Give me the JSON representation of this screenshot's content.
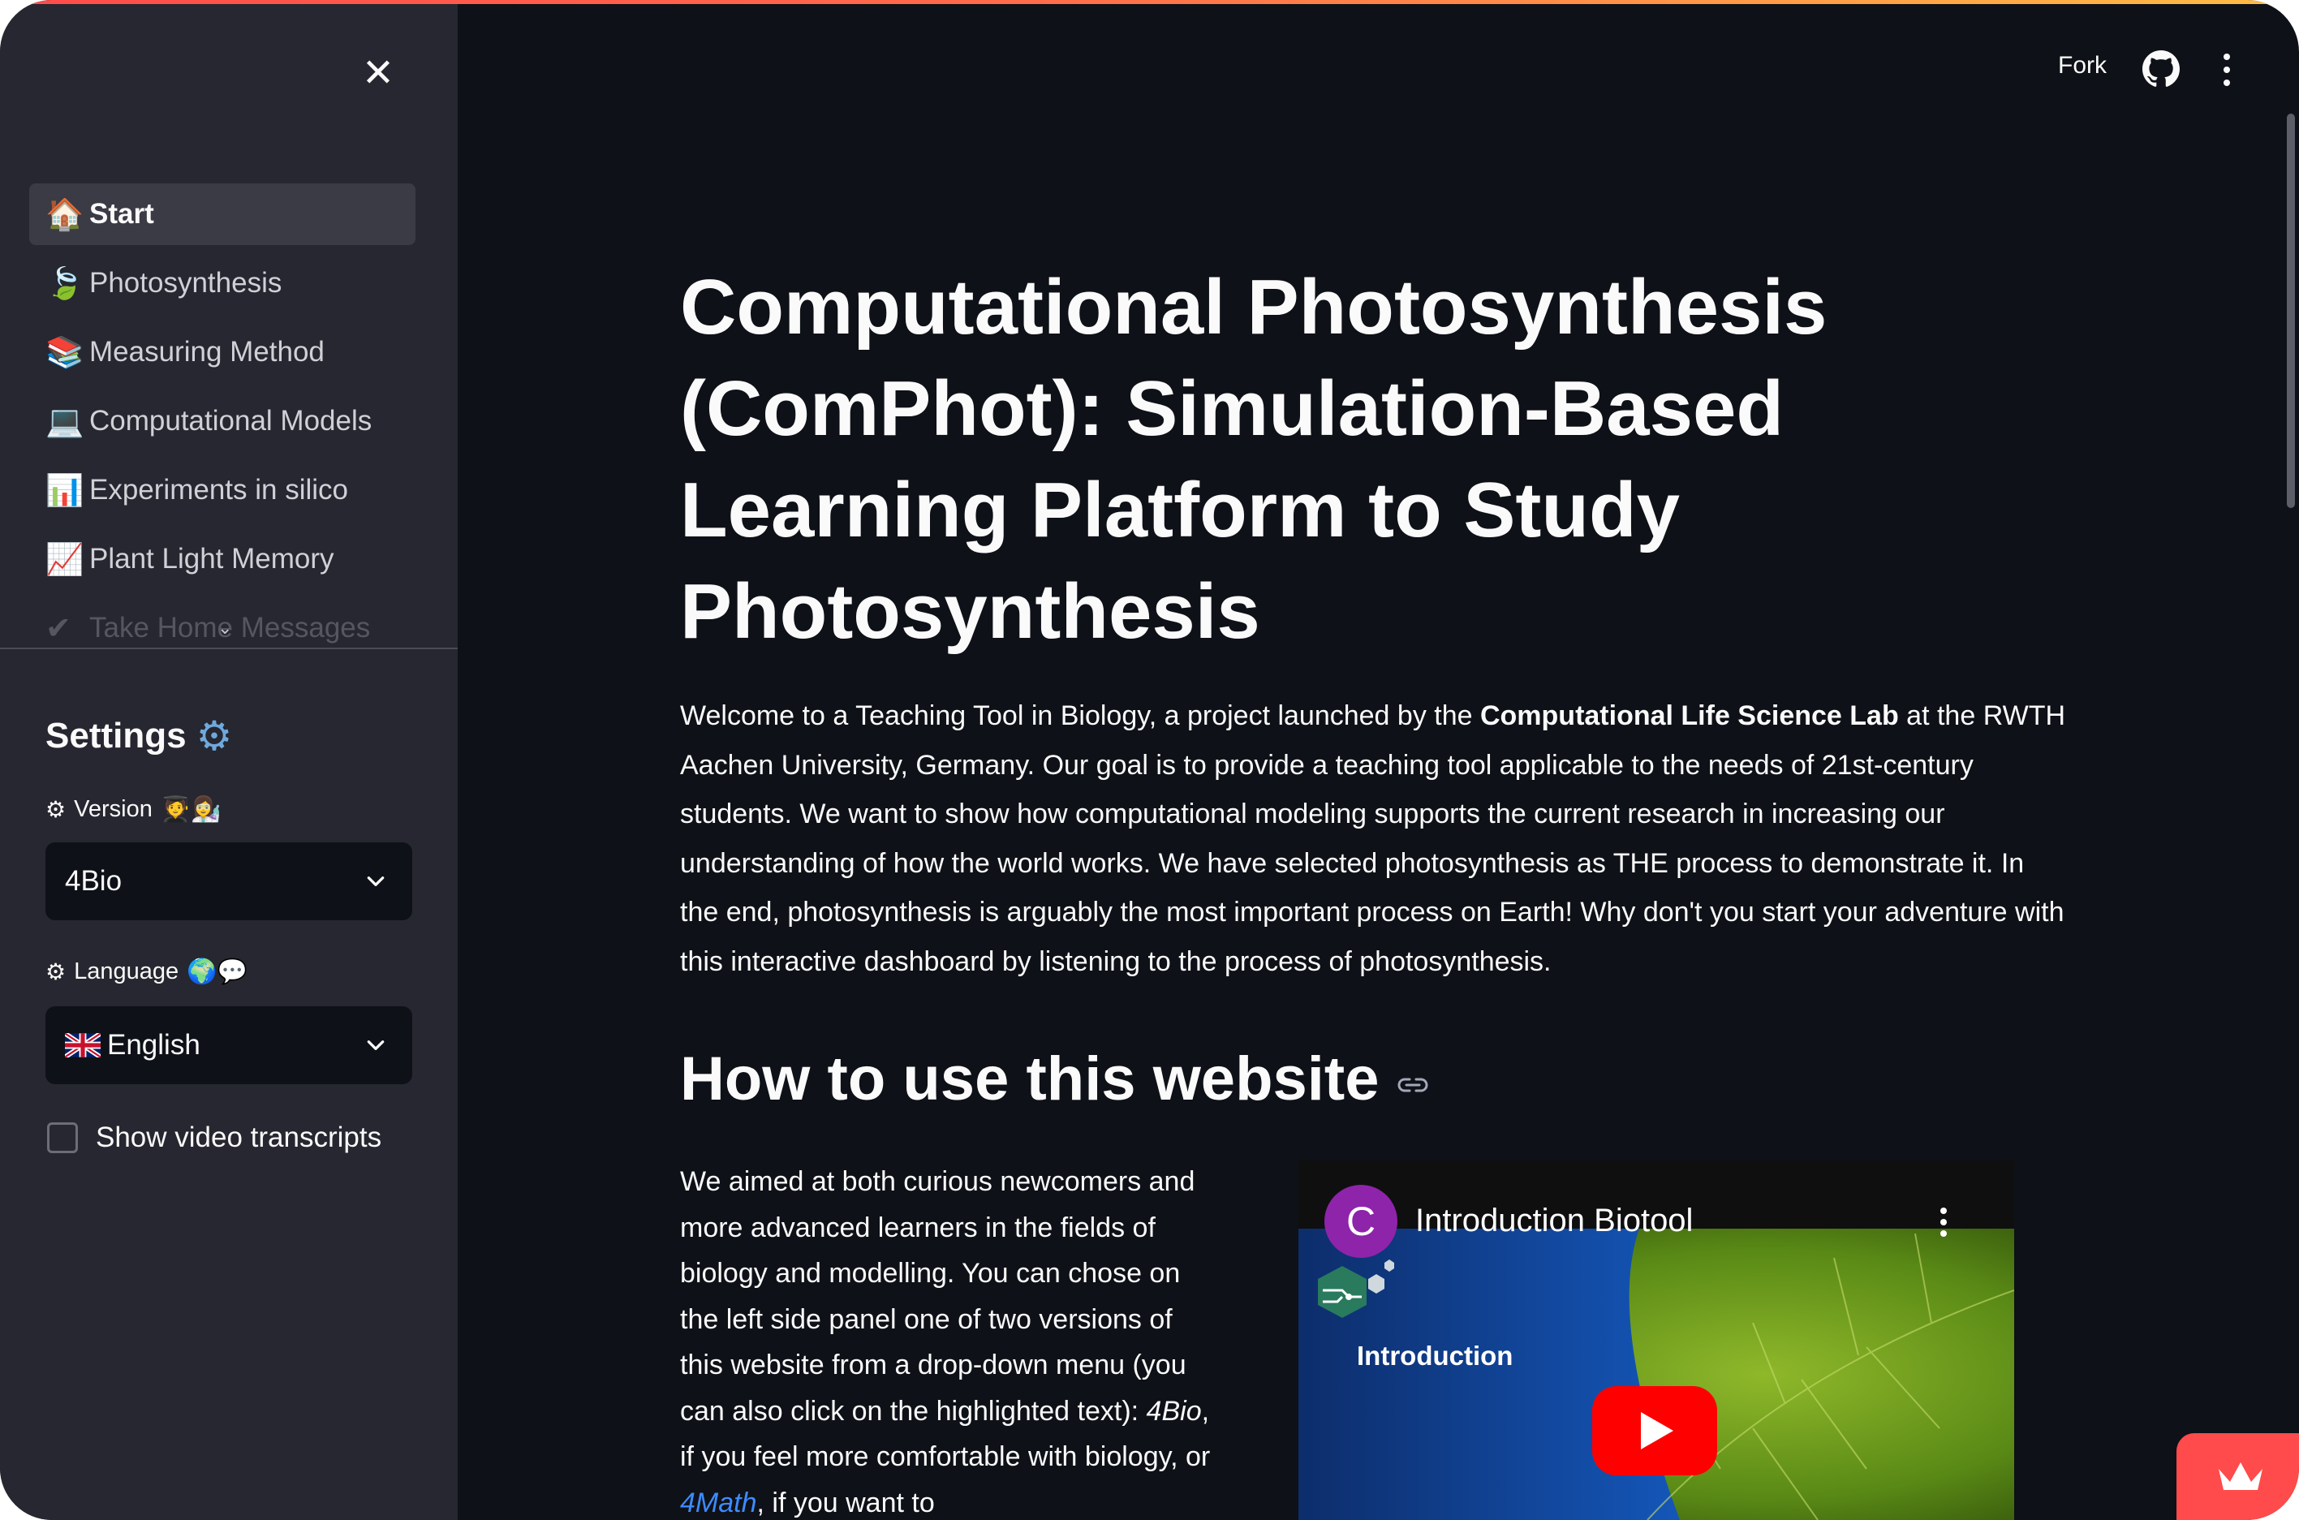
{
  "header": {
    "fork_label": "Fork",
    "github_icon": "github-icon",
    "menu_icon": "kebab-menu-icon"
  },
  "sidebar": {
    "close_icon": "close-icon",
    "nav": [
      {
        "icon": "🏠",
        "label": "Start",
        "active": true
      },
      {
        "icon": "🍃",
        "label": "Photosynthesis"
      },
      {
        "icon": "📚",
        "label": "Measuring Method"
      },
      {
        "icon": "💻",
        "label": "Computational Models"
      },
      {
        "icon": "📊",
        "label": "Experiments in silico"
      },
      {
        "icon": "📈",
        "label": "Plant Light Memory"
      },
      {
        "icon": "✔",
        "label": "Take Home Messages"
      }
    ],
    "settings_title": "Settings",
    "settings_icon": "⚙",
    "version": {
      "label": "Version",
      "label_icon": "⚙",
      "emoji": "🧑‍🎓👩‍🔬",
      "value": "4Bio"
    },
    "language": {
      "label": "Language",
      "label_icon": "⚙",
      "emoji": "🌍💬",
      "value": "English",
      "flag": "uk-flag-icon"
    },
    "transcripts": {
      "label": "Show video transcripts",
      "checked": false
    }
  },
  "main": {
    "title": "Computational Photosynthesis (ComPhot): Simulation-Based Learning Platform to Study Photosynthesis",
    "intro_1": "Welcome to a Teaching Tool in Biology, a project launched by the ",
    "intro_bold": "Computational Life Science Lab",
    "intro_2": " at the RWTH Aachen University, Germany. Our goal is to provide a teaching tool applicable to the needs of 21st-century students. We want to show how computational modeling supports the current research in increasing our understanding of how the world works. We have selected photosynthesis as THE process to demonstrate it. In the end, photosynthesis is arguably the most important process on Earth! Why don't you start your adventure with this interactive dashboard by listening to the process of photosynthesis.",
    "section_title": "How to use this website",
    "body_1": "We aimed at both curious newcomers and more advanced learners in the fields of biology and modelling. You can chose on the left side panel one of two versions of this website from a drop-down menu (you can also click on the highlighted text): ",
    "body_version_1": "4Bio",
    "body_2": ", if you feel more comfortable with biology, or ",
    "body_link": "4Math",
    "body_3": ", if you want to"
  },
  "video": {
    "channel_initial": "C",
    "title": "Introduction Biotool",
    "slide_text": "Introduction",
    "play_icon": "youtube-play-icon"
  },
  "colors": {
    "background": "#0e1117",
    "sidebar": "#262730",
    "accent": "#ff4b4b",
    "link": "#3d8bfd"
  }
}
